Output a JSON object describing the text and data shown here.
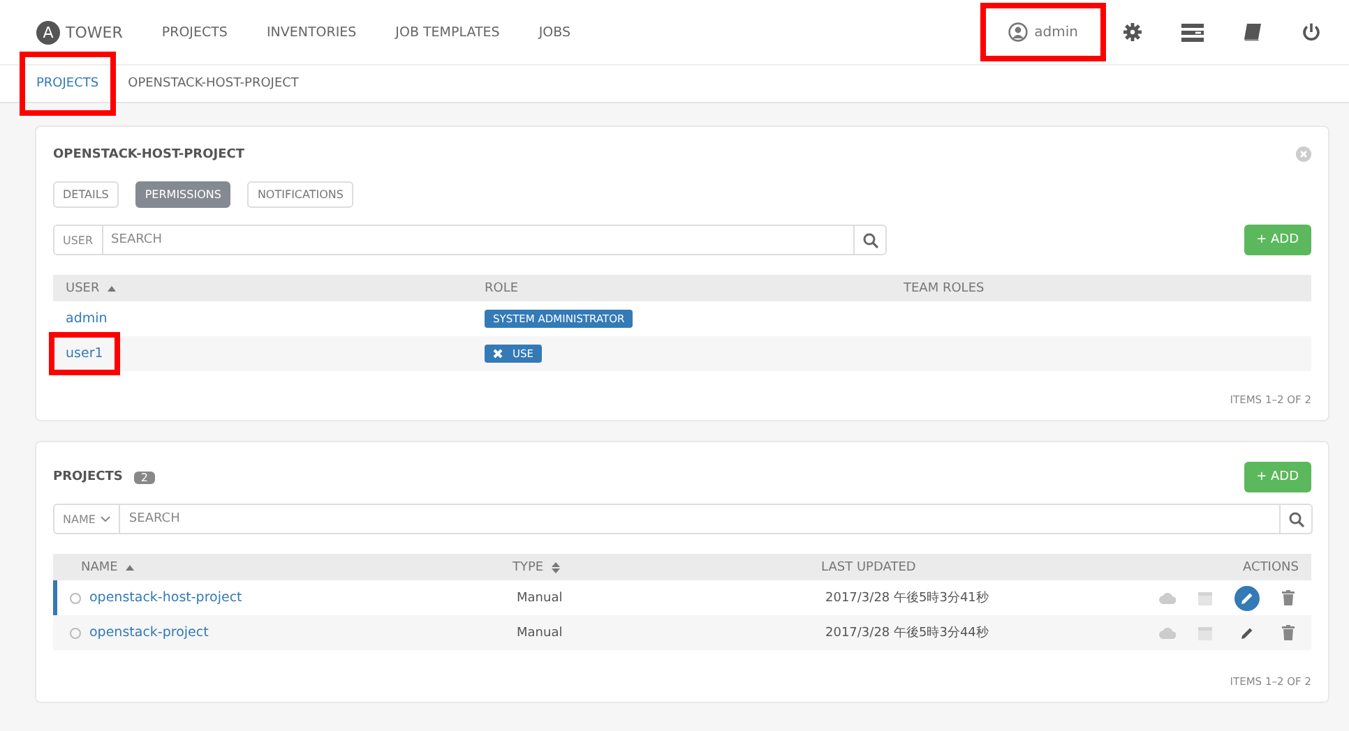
{
  "nav": {
    "brand": "TOWER",
    "logo_letter": "A",
    "links": [
      "PROJECTS",
      "INVENTORIES",
      "JOB TEMPLATES",
      "JOBS"
    ],
    "user": {
      "name": "admin",
      "highlighted": true
    }
  },
  "breadcrumb": [
    {
      "label": "PROJECTS",
      "link": true,
      "highlighted": true
    },
    {
      "label": "OPENSTACK-HOST-PROJECT",
      "link": false,
      "highlighted": false
    }
  ],
  "project_card": {
    "title": "OPENSTACK-HOST-PROJECT",
    "tabs": [
      {
        "label": "DETAILS",
        "selected": false
      },
      {
        "label": "PERMISSIONS",
        "selected": true
      },
      {
        "label": "NOTIFICATIONS",
        "selected": false
      }
    ],
    "search": {
      "scope": "USER",
      "placeholder": "SEARCH"
    },
    "add_button": "+ ADD",
    "columns": [
      "USER",
      "ROLE",
      "TEAM ROLES"
    ],
    "rows": [
      {
        "user": "admin",
        "highlighted": false,
        "role": "SYSTEM ADMINISTRATOR",
        "removable": false
      },
      {
        "user": "user1",
        "highlighted": true,
        "role": "USE",
        "removable": true
      }
    ],
    "footer": "ITEMS 1–2 OF 2"
  },
  "projects_card": {
    "title": "PROJECTS",
    "count": "2",
    "add_button": "+ ADD",
    "search": {
      "scope": "NAME",
      "placeholder": "SEARCH"
    },
    "columns": [
      "NAME",
      "TYPE",
      "LAST UPDATED",
      "ACTIONS"
    ],
    "rows": [
      {
        "name": "openstack-host-project",
        "type": "Manual",
        "last_updated": "2017/3/28 午後5時3分41秒",
        "selected": true
      },
      {
        "name": "openstack-project",
        "type": "Manual",
        "last_updated": "2017/3/28 午後5時3分44秒",
        "selected": false
      }
    ],
    "footer": "ITEMS 1–2 OF 2"
  }
}
